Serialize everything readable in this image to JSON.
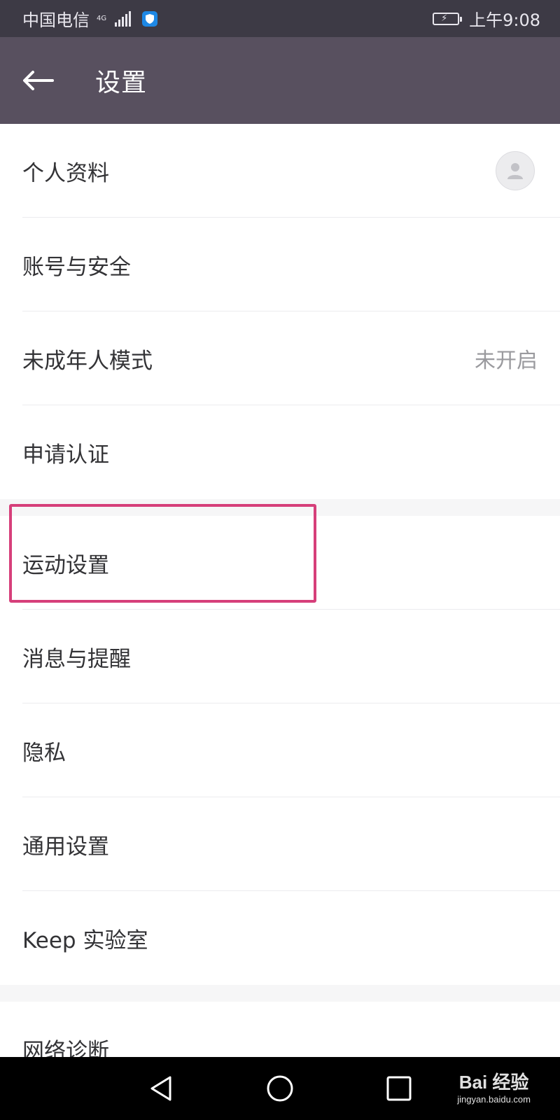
{
  "status_bar": {
    "carrier": "中国电信",
    "network": "4G",
    "time": "上午9:08"
  },
  "app_bar": {
    "title": "设置"
  },
  "groups": [
    {
      "items": [
        {
          "label": "个人资料",
          "trailing": "avatar"
        },
        {
          "label": "账号与安全"
        },
        {
          "label": "未成年人模式",
          "value": "未开启"
        },
        {
          "label": "申请认证"
        }
      ]
    },
    {
      "items": [
        {
          "label": "运动设置",
          "highlighted": true
        },
        {
          "label": "消息与提醒"
        },
        {
          "label": "隐私"
        },
        {
          "label": "通用设置"
        },
        {
          "label": "Keep 实验室"
        }
      ]
    },
    {
      "items": [
        {
          "label": "网络诊断"
        }
      ]
    }
  ],
  "watermark": {
    "brand": "Bai 经验",
    "url": "jingyan.baidu.com"
  },
  "colors": {
    "status_bar_bg": "#3d3a45",
    "app_bar_bg": "#58505f",
    "highlight_border": "#d63f7a"
  }
}
